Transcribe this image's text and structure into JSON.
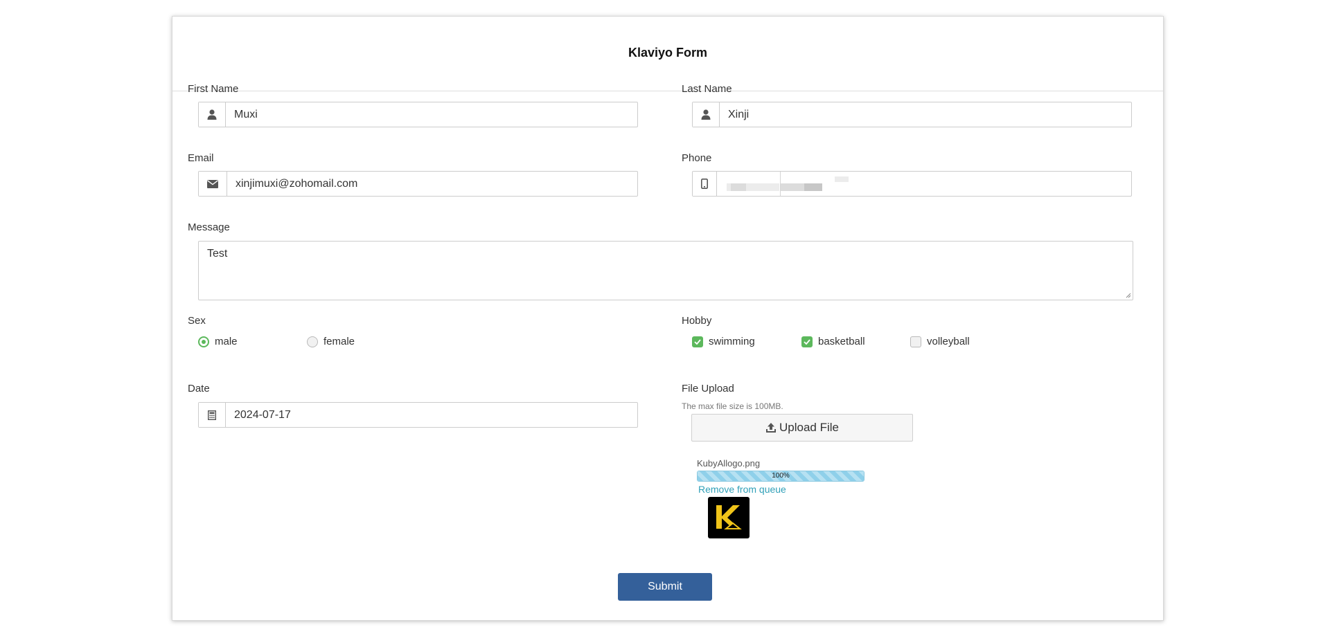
{
  "form": {
    "title": "Klaviyo Form",
    "submit_label": "Submit"
  },
  "fields": {
    "first_name": {
      "label": "First Name",
      "value": "Muxi",
      "icon": "user-icon"
    },
    "last_name": {
      "label": "Last Name",
      "value": "Xinji",
      "icon": "user-icon"
    },
    "email": {
      "label": "Email",
      "value": "xinjimuxi@zohomail.com",
      "icon": "envelope-icon"
    },
    "phone": {
      "label": "Phone",
      "value": "",
      "icon": "mobile-phone-icon",
      "value_redacted": true
    },
    "message": {
      "label": "Message",
      "value": "Test"
    },
    "sex": {
      "label": "Sex",
      "options": [
        {
          "label": "male",
          "selected": true
        },
        {
          "label": "female",
          "selected": false
        }
      ]
    },
    "hobby": {
      "label": "Hobby",
      "options": [
        {
          "label": "swimming",
          "checked": true
        },
        {
          "label": "basketball",
          "checked": true
        },
        {
          "label": "volleyball",
          "checked": false
        }
      ]
    },
    "date": {
      "label": "Date",
      "value": "2024-07-17",
      "icon": "calculator-icon"
    },
    "file_upload": {
      "label": "File Upload",
      "hint": "The max file size is 100MB.",
      "button_label": "Upload File",
      "button_icon": "upload-icon",
      "file": {
        "name": "KubyAllogo.png",
        "progress_text": "100%",
        "progress": 1.0,
        "remove_label": "Remove from queue"
      }
    }
  },
  "colors": {
    "accent_green": "#5cb85c",
    "submit_blue": "#34609a",
    "link_teal": "#31a0b8",
    "logo_yellow": "#f0c419",
    "logo_black": "#000000"
  }
}
